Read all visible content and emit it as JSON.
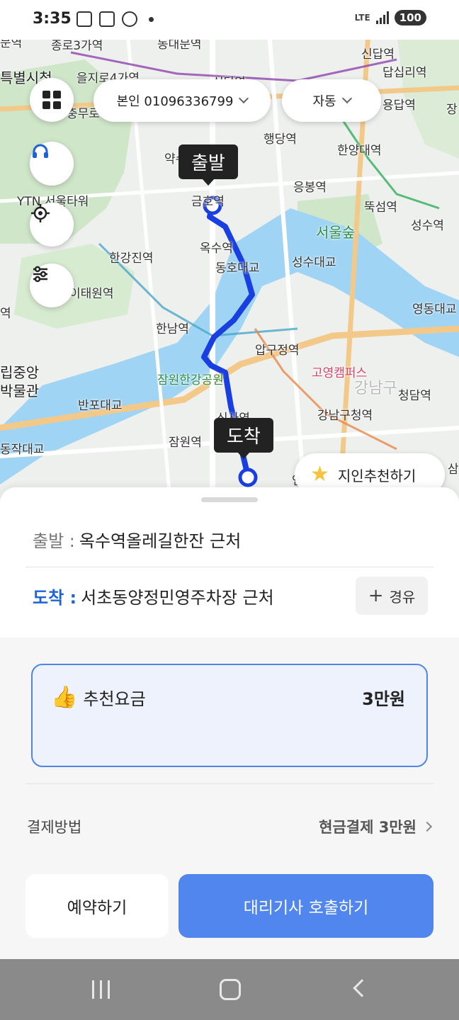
{
  "status": {
    "time": "3:35",
    "network": "LTE",
    "battery": "100"
  },
  "map": {
    "top_bar": {
      "account_label": "본인 01096336799",
      "mode_label": "자동"
    },
    "markers": {
      "start": "출발",
      "end": "도착"
    },
    "recommend_label": "지인추천하기",
    "labels": [
      "문역",
      "종로3가역",
      "동대문역",
      "신답역",
      "특별시청",
      "을지로4가역",
      "답십리역",
      "충무로",
      "신당역",
      "용답역",
      "장",
      "행당역",
      "약수역",
      "한양대역",
      "YTN 서울타워",
      "응봉역",
      "금호역",
      "뚝섬역",
      "서울숲",
      "성수역",
      "한강진역",
      "옥수역",
      "동호대교",
      "성수대교",
      "이태원역",
      "영동대교",
      "역",
      "한남역",
      "압구정역",
      "고영캠퍼스",
      "강남구",
      "립중앙",
      "박물관",
      "잠원한강공원",
      "반포대교",
      "청담역",
      "강남구청역",
      "신사역",
      "동작대교",
      "잠원역",
      "언주역",
      "삼"
    ]
  },
  "trip": {
    "start_label": "출발 :",
    "start_value": "옥수역올레길한잔 근처",
    "end_label": "도착 :",
    "end_value": "서초동양정민영주차장 근처",
    "waypoint_label": "경유"
  },
  "fare": {
    "label": "추천요금",
    "value": "3만원"
  },
  "payment": {
    "label": "결제방법",
    "value": "현금결제 3만원"
  },
  "actions": {
    "reserve": "예약하기",
    "call": "대리기사 호출하기"
  },
  "colors": {
    "accent": "#5086ee",
    "route": "#1a3fe0",
    "end_label": "#1e63d6"
  }
}
